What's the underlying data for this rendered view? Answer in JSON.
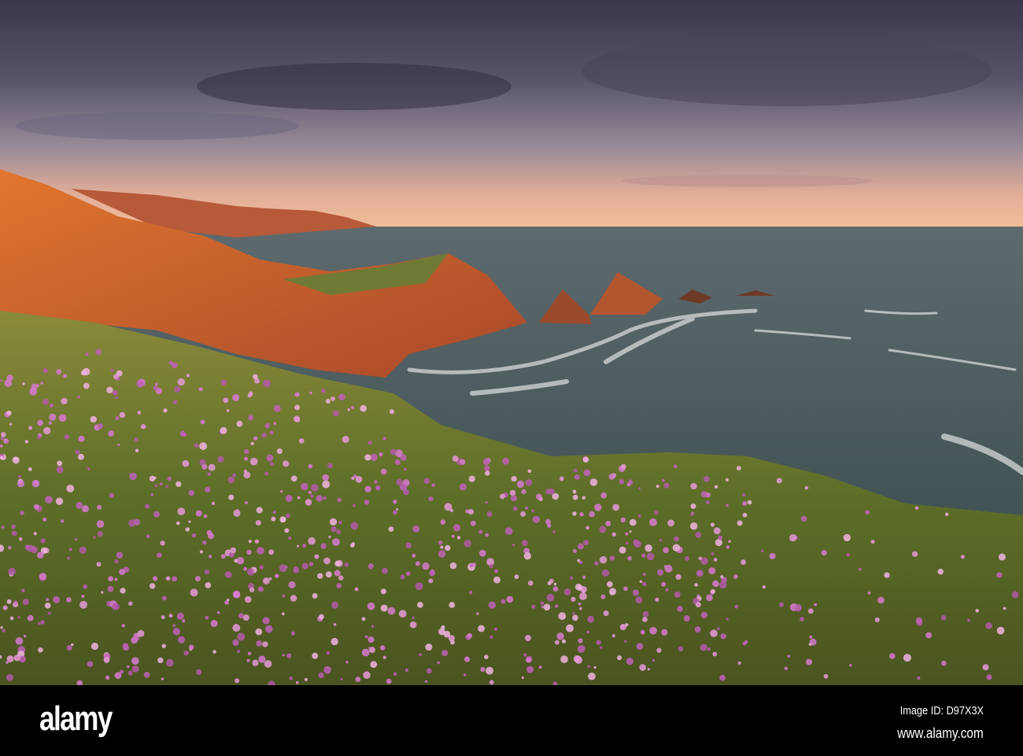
{
  "footer": {
    "logo": "alamy",
    "image_id": "Image ID: D97X3X",
    "website": "www.alamy.com"
  },
  "colors": {
    "sky_top": "#3d3a4f",
    "sky_horizon": "#f0b48f",
    "sea": "#4a5a5c",
    "cliff": "#d0602a",
    "grass": "#6b7a2a",
    "flower": "#d77ad0"
  }
}
